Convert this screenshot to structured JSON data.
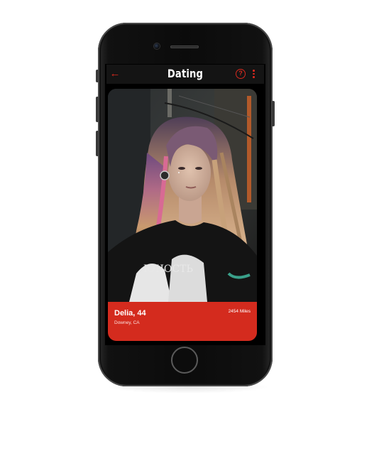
{
  "app": {
    "title": "Dating"
  },
  "header": {
    "back_icon": "arrow-left-icon",
    "help_icon": "question-circle-icon",
    "help_glyph": "?",
    "more_icon": "more-vertical-icon"
  },
  "profile": {
    "name_age": "Delia, 44",
    "location": "Downey, CA",
    "distance": "2454 Miles"
  },
  "colors": {
    "accent": "#d42b1e",
    "header_bg": "#141414",
    "screen_bg": "#000000"
  }
}
